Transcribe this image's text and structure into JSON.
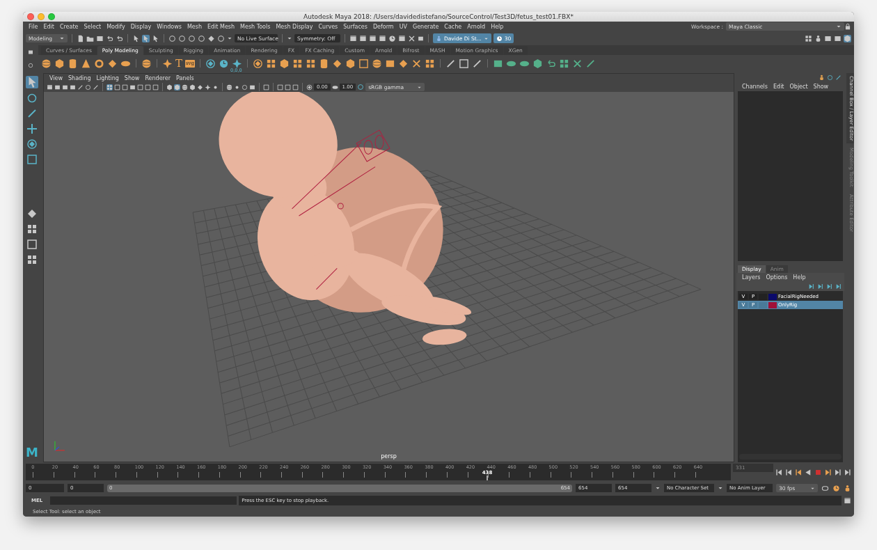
{
  "window": {
    "title": "Autodesk Maya 2018: /Users/davidedistefano/SourceControl/Test3D/fetus_test01.FBX*"
  },
  "menu_bar": [
    "File",
    "Edit",
    "Create",
    "Select",
    "Modify",
    "Display",
    "Windows",
    "Mesh",
    "Edit Mesh",
    "Mesh Tools",
    "Mesh Display",
    "Curves",
    "Surfaces",
    "Deform",
    "UV",
    "Generate",
    "Cache",
    "Arnold",
    "Help"
  ],
  "workspace": {
    "label": "Workspace :",
    "value": "Maya Classic"
  },
  "status_line": {
    "menu_set": "Modeling",
    "live_surface": "No Live Surface",
    "symmetry": "Symmetry: Off",
    "user": "Davide Di St...",
    "credits": "30"
  },
  "shelf": {
    "tabs": [
      {
        "label": "Curves / Surfaces",
        "selected": false
      },
      {
        "label": "Poly Modeling",
        "selected": true
      },
      {
        "label": "Sculpting",
        "selected": false
      },
      {
        "label": "Rigging",
        "selected": false
      },
      {
        "label": "Animation",
        "selected": false
      },
      {
        "label": "Rendering",
        "selected": false
      },
      {
        "label": "FX",
        "selected": false
      },
      {
        "label": "FX Caching",
        "selected": false
      },
      {
        "label": "Custom",
        "selected": false
      },
      {
        "label": "Arnold",
        "selected": false
      },
      {
        "label": "Bifrost",
        "selected": false
      },
      {
        "label": "MASH",
        "selected": false
      },
      {
        "label": "Motion Graphics",
        "selected": false
      },
      {
        "label": "XGen",
        "selected": false
      }
    ],
    "text_icon": "T",
    "svg_icon": "svg",
    "caption": "0,0,0"
  },
  "viewport": {
    "menu": [
      "View",
      "Shading",
      "Lighting",
      "Show",
      "Renderer",
      "Panels"
    ],
    "exposure": "0.00",
    "gamma": "1.00",
    "color_space": "sRGB gamma",
    "camera": "persp"
  },
  "logo": "M",
  "channel_box": {
    "menu": [
      "Channels",
      "Edit",
      "Object",
      "Show"
    ]
  },
  "side_tabs": [
    {
      "label": "Channel Box / Layer Editor",
      "selected": true
    },
    {
      "label": "Modeling Toolkit",
      "selected": false
    },
    {
      "label": "Attribute Editor",
      "selected": false
    }
  ],
  "layer_editor": {
    "tabs": [
      {
        "label": "Display",
        "selected": true
      },
      {
        "label": "Anim",
        "selected": false
      }
    ],
    "menu": [
      "Layers",
      "Options",
      "Help"
    ],
    "layers": [
      {
        "visible": "V",
        "playback": "P",
        "name": "FacialRigNeeded",
        "color": "#0a0a6a",
        "selected": false
      },
      {
        "visible": "V",
        "playback": "P",
        "name": "OnlyRig",
        "color": "#a01038",
        "selected": true
      }
    ]
  },
  "time_slider": {
    "ticks": [
      "0",
      "20",
      "40",
      "60",
      "80",
      "100",
      "120",
      "140",
      "160",
      "180",
      "200",
      "220",
      "240",
      "260",
      "280",
      "300",
      "320",
      "340",
      "360",
      "380",
      "400",
      "420",
      "440",
      "460",
      "480",
      "500",
      "520",
      "540",
      "560",
      "580",
      "600",
      "620",
      "640"
    ],
    "current_frame": "438",
    "level": 0.67,
    "current_field": "331"
  },
  "range_slider": {
    "start": "0",
    "playback_start": "0",
    "bar_start": "0",
    "bar_end": "654",
    "playback_end": "654",
    "end": "654",
    "character_set": "No Character Set",
    "anim_layer": "No Anim Layer",
    "fps": "30 fps"
  },
  "command_line": {
    "label": "MEL",
    "feedback": "Press the ESC key to stop playback."
  },
  "help_line": "Select Tool: select an object"
}
